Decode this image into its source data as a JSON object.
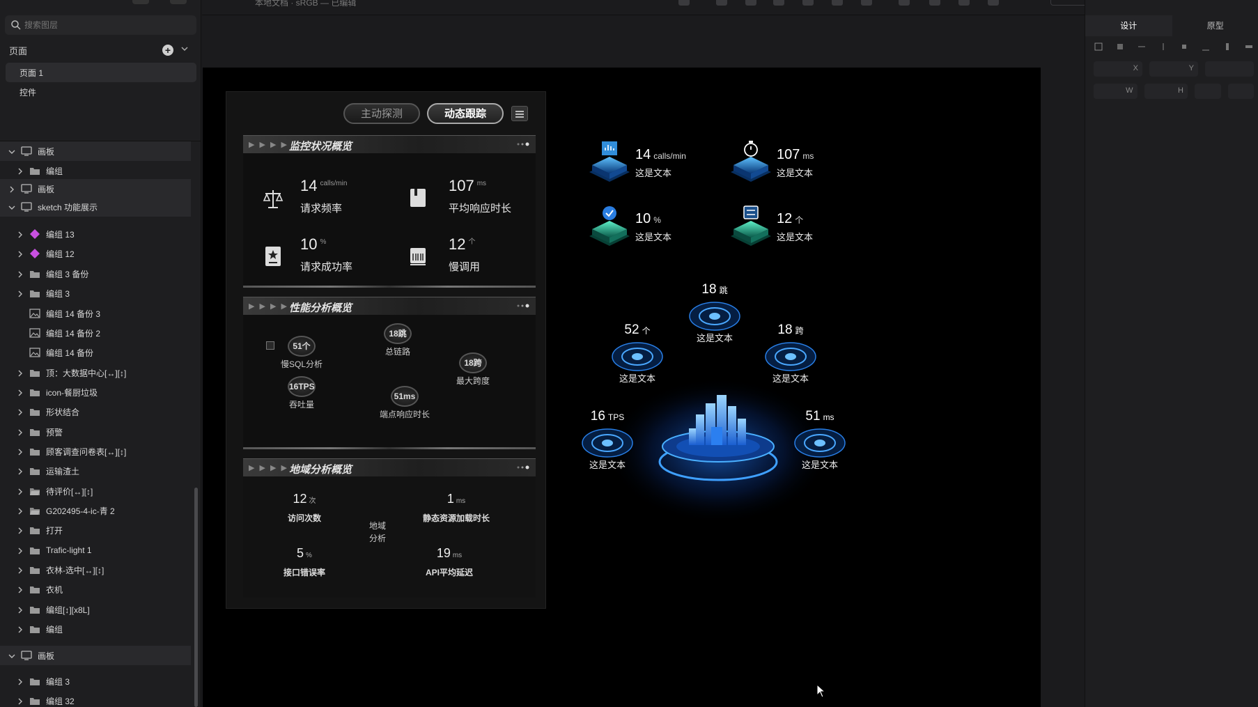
{
  "toolbar": {
    "doc_title": "本地文档 · sRGB — 已编辑"
  },
  "sidebar": {
    "search_placeholder": "搜索图层",
    "pages_label": "页面",
    "pages": [
      {
        "label": "页面 1",
        "active": true
      },
      {
        "label": "控件",
        "active": false
      }
    ],
    "layers": [
      {
        "label": "画板",
        "kind": "board",
        "expanded": true,
        "indent": 0
      },
      {
        "label": "编组",
        "kind": "folder",
        "expanded": false,
        "indent": 1
      },
      {
        "label": "画板",
        "kind": "board",
        "expanded": false,
        "indent": 0
      },
      {
        "label": "sketch 功能展示",
        "kind": "board",
        "expanded": true,
        "indent": 0
      },
      {
        "label": "编组 13",
        "kind": "symbol",
        "expanded": false,
        "indent": 1
      },
      {
        "label": "编组 12",
        "kind": "symbol",
        "expanded": false,
        "indent": 1
      },
      {
        "label": "编组 3 备份",
        "kind": "folder",
        "expanded": false,
        "indent": 1
      },
      {
        "label": "编组 3",
        "kind": "folder",
        "expanded": false,
        "indent": 1
      },
      {
        "label": "编组 14 备份 3",
        "kind": "image",
        "expanded": false,
        "indent": 1
      },
      {
        "label": "编组 14 备份 2",
        "kind": "image",
        "expanded": false,
        "indent": 1
      },
      {
        "label": "编组 14 备份",
        "kind": "image",
        "expanded": false,
        "indent": 1
      },
      {
        "label": "顶：大数据中心[↔][↕]",
        "kind": "folder",
        "expanded": false,
        "indent": 1
      },
      {
        "label": "icon-餐厨垃圾",
        "kind": "folder",
        "expanded": false,
        "indent": 1
      },
      {
        "label": "形状结合",
        "kind": "folder",
        "expanded": false,
        "indent": 1
      },
      {
        "label": "预警",
        "kind": "folder",
        "expanded": false,
        "indent": 1
      },
      {
        "label": "顾客调查问卷表[↔][↕]",
        "kind": "folder",
        "expanded": false,
        "indent": 1
      },
      {
        "label": "运输渣土",
        "kind": "folder",
        "expanded": false,
        "indent": 1
      },
      {
        "label": "待评价[↔][↕]",
        "kind": "folder-open",
        "expanded": false,
        "indent": 1
      },
      {
        "label": "G202495-4-ic-青 2",
        "kind": "folder-open",
        "expanded": false,
        "indent": 1
      },
      {
        "label": "打开",
        "kind": "folder",
        "expanded": false,
        "indent": 1
      },
      {
        "label": "Trafic-light 1",
        "kind": "folder",
        "expanded": false,
        "indent": 1
      },
      {
        "label": "衣林-选中[↔][↕]",
        "kind": "folder",
        "expanded": false,
        "indent": 1
      },
      {
        "label": "衣机",
        "kind": "folder",
        "expanded": false,
        "indent": 1
      },
      {
        "label": "编组[↕][x8L]",
        "kind": "folder",
        "expanded": false,
        "indent": 1
      },
      {
        "label": "编组",
        "kind": "folder",
        "expanded": false,
        "indent": 1
      },
      {
        "label": "画板",
        "kind": "board",
        "expanded": true,
        "indent": 0
      },
      {
        "label": "编组 3",
        "kind": "folder",
        "expanded": false,
        "indent": 1
      },
      {
        "label": "编组 32",
        "kind": "folder",
        "expanded": false,
        "indent": 1
      }
    ]
  },
  "inspector": {
    "tabs": [
      {
        "label": "设计",
        "active": true
      },
      {
        "label": "原型",
        "active": false
      }
    ],
    "fields": {
      "x": "X",
      "y": "Y",
      "w": "W",
      "h": "H"
    }
  },
  "panel": {
    "tabs": [
      {
        "label": "主动探测",
        "active": false
      },
      {
        "label": "动态跟踪",
        "active": true
      }
    ],
    "monitor": {
      "title": "监控状况概览",
      "metrics": [
        {
          "value": "14",
          "unit": "calls/min",
          "name": "请求频率",
          "icon": "scale-icon"
        },
        {
          "value": "107",
          "unit": "ms",
          "name": "平均响应时长",
          "icon": "book-icon"
        },
        {
          "value": "10",
          "unit": "%",
          "name": "请求成功率",
          "icon": "certificate-icon"
        },
        {
          "value": "12",
          "unit": "个",
          "name": "慢调用",
          "icon": "barcode-icon"
        }
      ]
    },
    "performance": {
      "title": "性能分析概览",
      "items": [
        {
          "value": "51个",
          "name": "慢SQL分析"
        },
        {
          "value": "18跳",
          "name": "总链路"
        },
        {
          "value": "18跨",
          "name": "最大跨度"
        },
        {
          "value": "16TPS",
          "name": "吞吐量"
        },
        {
          "value": "51ms",
          "name": "端点响应时长"
        }
      ]
    },
    "region": {
      "title": "地域分析概览",
      "center_label_1": "地域",
      "center_label_2": "分析",
      "items": [
        {
          "value": "12",
          "unit": "次",
          "name": "访问次数"
        },
        {
          "value": "1",
          "unit": "ms",
          "name": "静态资源加载时长"
        },
        {
          "value": "5",
          "unit": "%",
          "name": "接口错误率"
        },
        {
          "value": "19",
          "unit": "ms",
          "name": "API平均延迟"
        }
      ]
    }
  },
  "viz": {
    "tiles": [
      {
        "value": "14",
        "unit": "calls/min",
        "name": "这是文本",
        "icon": "chart-cube-icon"
      },
      {
        "value": "107",
        "unit": "ms",
        "name": "这是文本",
        "icon": "stopwatch-cube-icon"
      },
      {
        "value": "10",
        "unit": "%",
        "name": "这是文本",
        "icon": "check-cube-icon"
      },
      {
        "value": "12",
        "unit": "个",
        "name": "这是文本",
        "icon": "transfer-cube-icon"
      }
    ],
    "nodes": [
      {
        "value": "18",
        "unit": "跳",
        "name": "这是文本"
      },
      {
        "value": "52",
        "unit": "个",
        "name": "这是文本"
      },
      {
        "value": "18",
        "unit": "跨",
        "name": "这是文本"
      },
      {
        "value": "16",
        "unit": "TPS",
        "name": "这是文本"
      },
      {
        "value": "51",
        "unit": "ms",
        "name": "这是文本"
      }
    ]
  },
  "colors": {
    "accent_blue": "#2d8cff",
    "teal": "#28c9a0",
    "artboard": "#000000",
    "sidebar": "#1e1e20"
  }
}
